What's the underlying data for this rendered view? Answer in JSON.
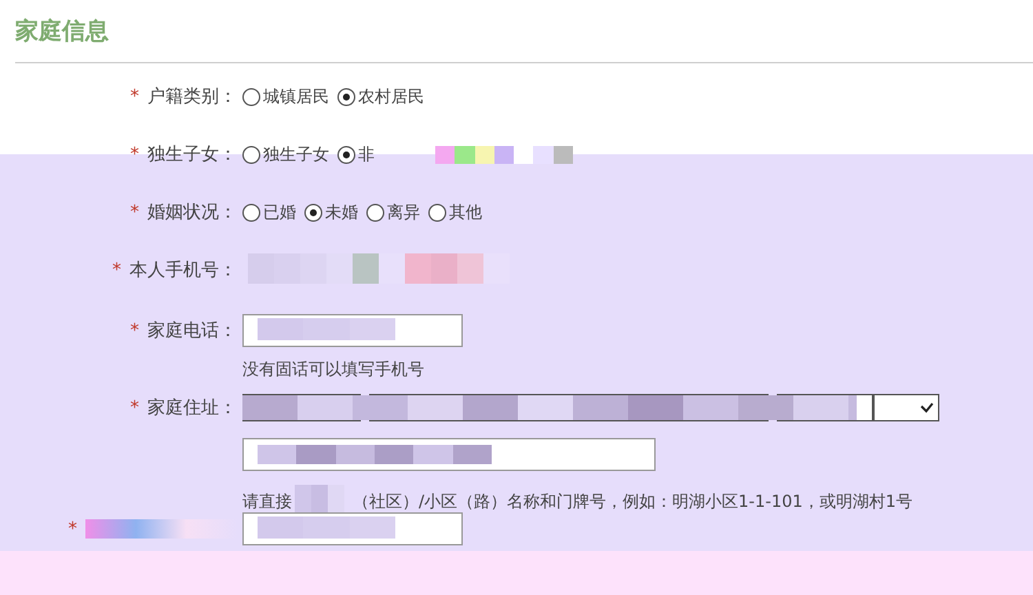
{
  "section_title": "家庭信息",
  "fields": [
    {
      "kind": "radio",
      "required_mark": "*",
      "label": "户籍类别：",
      "options": [
        {
          "label": "城镇居民",
          "selected": false
        },
        {
          "label": "农村居民",
          "selected": true
        }
      ]
    },
    {
      "kind": "radio",
      "required_mark": "*",
      "label": "独生子女：",
      "redacted": true,
      "options": [
        {
          "label": "独生子女",
          "selected": false
        },
        {
          "label": "非",
          "selected": true
        }
      ]
    },
    {
      "kind": "radio",
      "required_mark": "*",
      "label": "婚姻状况：",
      "options": [
        {
          "label": "已婚",
          "selected": false
        },
        {
          "label": "未婚",
          "selected": true
        },
        {
          "label": "离异",
          "selected": false
        },
        {
          "label": "其他",
          "selected": false
        }
      ]
    },
    {
      "kind": "text",
      "required_mark": "*",
      "label": "本人手机号：",
      "redacted": true
    },
    {
      "kind": "input",
      "required_mark": "*",
      "label": "家庭电话：",
      "redacted": true,
      "hint": "没有固话可以填写手机号"
    },
    {
      "kind": "address",
      "required_mark": "*",
      "label": "家庭住址：",
      "redacted": true,
      "hint_parts": [
        "请直接",
        "（社区）/小区（路）名称和门牌号，例如：明湖小区1-1-101，或明湖村1号"
      ]
    },
    {
      "kind": "input",
      "required_mark": "*",
      "redacted": true
    }
  ]
}
